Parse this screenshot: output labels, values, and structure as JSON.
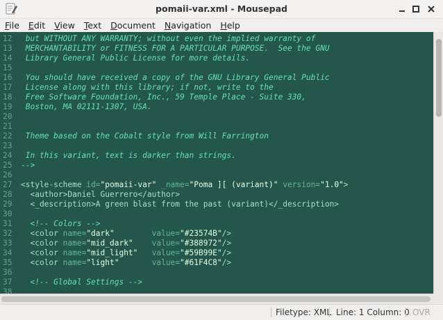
{
  "window": {
    "title": "pomaii-var.xml - Mousepad",
    "icon": "text-editor-icon",
    "controls": [
      "minimize",
      "maximize",
      "close"
    ]
  },
  "menubar": {
    "items": [
      {
        "label": "File",
        "mnemonic": "F"
      },
      {
        "label": "Edit",
        "mnemonic": "E"
      },
      {
        "label": "View",
        "mnemonic": "V"
      },
      {
        "label": "Text",
        "mnemonic": "T"
      },
      {
        "label": "Document",
        "mnemonic": "D"
      },
      {
        "label": "Navigation",
        "mnemonic": "N"
      },
      {
        "label": "Help",
        "mnemonic": "H"
      }
    ]
  },
  "editor": {
    "colors": {
      "background": "#24574b",
      "line_numbers": "#5fa28d",
      "comment": "#66e0b3",
      "tag": "#9de3c7",
      "attribute": "#62b59a",
      "string": "#e4ffe4"
    },
    "lines": [
      {
        "n": "12",
        "parts": [
          {
            "t": "comment",
            "s": " but WITHOUT ANY WARRANTY; without even the implied warranty of"
          }
        ]
      },
      {
        "n": "13",
        "parts": [
          {
            "t": "comment",
            "s": " MERCHANTABILITY or FITNESS FOR A PARTICULAR PURPOSE.  See the GNU"
          }
        ]
      },
      {
        "n": "14",
        "parts": [
          {
            "t": "comment",
            "s": " Library General Public License for more details."
          }
        ]
      },
      {
        "n": "15",
        "parts": []
      },
      {
        "n": "16",
        "parts": [
          {
            "t": "comment",
            "s": " You should have received a copy of the GNU Library General Public"
          }
        ]
      },
      {
        "n": "17",
        "parts": [
          {
            "t": "comment",
            "s": " License along with this library; if not, write to the"
          }
        ]
      },
      {
        "n": "18",
        "parts": [
          {
            "t": "comment",
            "s": " Free Software Foundation, Inc., 59 Temple Place - Suite 330,"
          }
        ]
      },
      {
        "n": "19",
        "parts": [
          {
            "t": "comment",
            "s": " Boston, MA 02111-1307, USA."
          }
        ]
      },
      {
        "n": "20",
        "parts": []
      },
      {
        "n": "21",
        "parts": []
      },
      {
        "n": "22",
        "parts": [
          {
            "t": "comment",
            "s": " Theme based on the Cobalt style from Will Farrington"
          }
        ]
      },
      {
        "n": "23",
        "parts": []
      },
      {
        "n": "24",
        "parts": [
          {
            "t": "comment",
            "s": " In this variant, text is darker than strings."
          }
        ]
      },
      {
        "n": "25",
        "parts": [
          {
            "t": "comment",
            "s": "-->"
          }
        ]
      },
      {
        "n": "26",
        "parts": []
      },
      {
        "n": "27",
        "parts": [
          {
            "t": "tag",
            "s": "<style-scheme "
          },
          {
            "t": "attr",
            "s": "id="
          },
          {
            "t": "str",
            "s": "\"pomaii-var\""
          },
          {
            "t": "attr",
            "s": " _name="
          },
          {
            "t": "str",
            "s": "\"Poma ][ (variant)\""
          },
          {
            "t": "attr",
            "s": " version="
          },
          {
            "t": "str",
            "s": "\"1.0\""
          },
          {
            "t": "tag",
            "s": ">"
          }
        ]
      },
      {
        "n": "28",
        "parts": [
          {
            "t": "tag",
            "s": "  <author>"
          },
          {
            "t": "text",
            "s": "Daniel Guerrero"
          },
          {
            "t": "tag",
            "s": "</author>"
          }
        ]
      },
      {
        "n": "29",
        "parts": [
          {
            "t": "tag",
            "s": "  <_description>"
          },
          {
            "t": "text",
            "s": "A green blast from the past (variant)"
          },
          {
            "t": "tag",
            "s": "</_description>"
          }
        ]
      },
      {
        "n": "30",
        "parts": []
      },
      {
        "n": "31",
        "parts": [
          {
            "t": "comment",
            "s": "  <!-- Colors -->"
          }
        ]
      },
      {
        "n": "32",
        "parts": [
          {
            "t": "tag",
            "s": "  <color "
          },
          {
            "t": "attr",
            "s": "name="
          },
          {
            "t": "str",
            "s": "\"dark\""
          },
          {
            "t": "attr",
            "s": "        value="
          },
          {
            "t": "str",
            "s": "\"#23574B\""
          },
          {
            "t": "tag",
            "s": "/>"
          }
        ]
      },
      {
        "n": "33",
        "parts": [
          {
            "t": "tag",
            "s": "  <color "
          },
          {
            "t": "attr",
            "s": "name="
          },
          {
            "t": "str",
            "s": "\"mid_dark\""
          },
          {
            "t": "attr",
            "s": "    value="
          },
          {
            "t": "str",
            "s": "\"#388972\""
          },
          {
            "t": "tag",
            "s": "/>"
          }
        ]
      },
      {
        "n": "34",
        "parts": [
          {
            "t": "tag",
            "s": "  <color "
          },
          {
            "t": "attr",
            "s": "name="
          },
          {
            "t": "str",
            "s": "\"mid_light\""
          },
          {
            "t": "attr",
            "s": "   value="
          },
          {
            "t": "str",
            "s": "\"#59B99E\""
          },
          {
            "t": "tag",
            "s": "/>"
          }
        ]
      },
      {
        "n": "35",
        "parts": [
          {
            "t": "tag",
            "s": "  <color "
          },
          {
            "t": "attr",
            "s": "name="
          },
          {
            "t": "str",
            "s": "\"light\""
          },
          {
            "t": "attr",
            "s": "       value="
          },
          {
            "t": "str",
            "s": "\"#61F4C8\""
          },
          {
            "t": "tag",
            "s": "/>"
          }
        ]
      },
      {
        "n": "36",
        "parts": []
      },
      {
        "n": "37",
        "parts": [
          {
            "t": "comment",
            "s": "  <!-- Global Settings -->"
          }
        ]
      },
      {
        "n": "38",
        "parts": []
      }
    ]
  },
  "statusbar": {
    "filetype": "Filetype: XML",
    "position": "Line: 1 Column: 0",
    "overwrite": "OVR"
  }
}
